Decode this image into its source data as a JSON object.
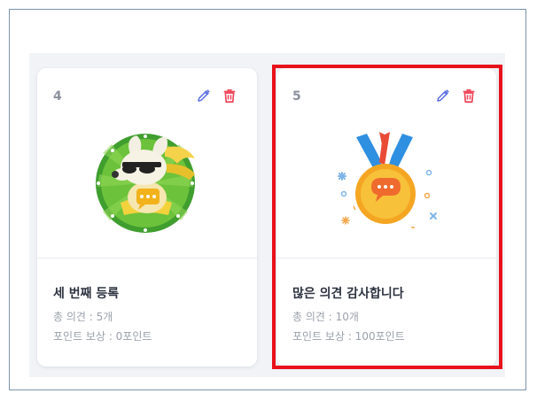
{
  "colors": {
    "edit_icon": "#5a6ee0",
    "delete_icon": "#f0455a",
    "highlight_border": "#e8121b"
  },
  "cards": [
    {
      "number": "4",
      "title": "세 번째 등록",
      "opinions": "총 의견 : 5개",
      "reward": "포인트 보상 : 0포인트",
      "badge_icon": "dog-sunglasses-badge-icon"
    },
    {
      "number": "5",
      "title": "많은 의견 감사합니다",
      "opinions": "총 의견 : 10개",
      "reward": "포인트 보상 : 100포인트",
      "badge_icon": "gold-medal-chat-icon"
    }
  ]
}
